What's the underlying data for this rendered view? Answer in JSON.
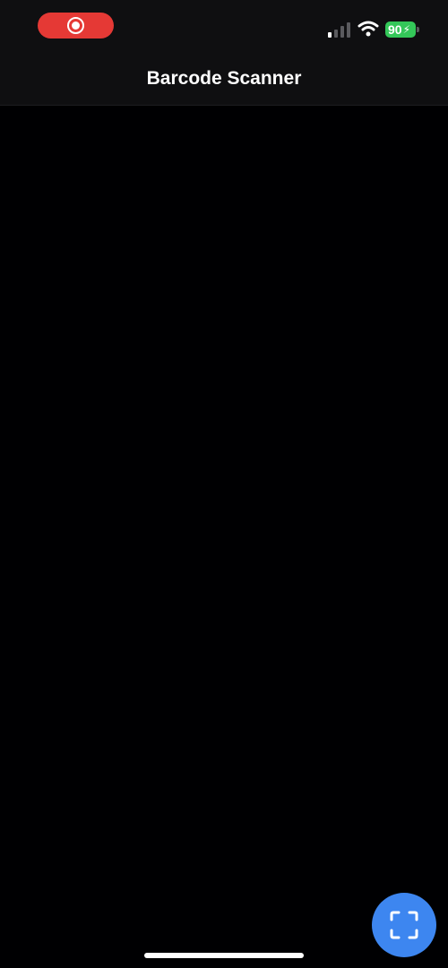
{
  "status_bar": {
    "battery_level": "90",
    "colors": {
      "recording": "#e53935",
      "battery": "#34c759"
    },
    "icons": [
      "record-icon",
      "signal-icon",
      "wifi-icon",
      "battery-icon",
      "bolt-icon"
    ]
  },
  "nav": {
    "title": "Barcode Scanner"
  },
  "scan_button": {
    "icon": "scan-frame-icon",
    "color": "#3d86f0"
  }
}
